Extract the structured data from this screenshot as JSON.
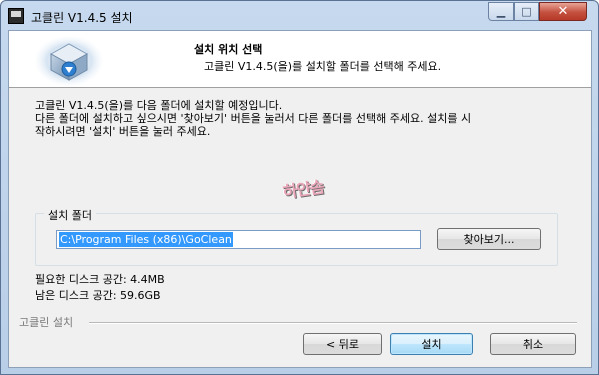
{
  "window": {
    "title": "고클린 V1.4.5 설치",
    "minimize_glyph": "▁",
    "maximize_glyph": "□",
    "close_glyph": "✕"
  },
  "header": {
    "title": "설치 위치 선택",
    "subtitle": "고클린 V1.4.5(을)를 설치할 폴더를 선택해 주세요."
  },
  "intro": {
    "line1": "고클린 V1.4.5(을)를 다음 폴더에 설치할 예정입니다.",
    "line2": "다른 폴더에 설치하고 싶으시면 '찾아보기' 버튼을 눌러서 다른 폴더를 선택해 주세요. 설치를 시",
    "line3": "작하시려면 '설치' 버튼을 눌러 주세요."
  },
  "watermark": {
    "text": "하얀솜"
  },
  "destination": {
    "group_label": "설치 폴더",
    "folder_value": "C:\\Program Files (x86)\\GoClean",
    "browse_label": "찾아보기..."
  },
  "space": {
    "required": "필요한 디스크 공간: 4.4MB",
    "available": "남은 디스크 공간: 59.6GB"
  },
  "footer": {
    "brand": "고클린 설치",
    "back_label": "< 뒤로",
    "install_label": "설치",
    "cancel_label": "취소"
  },
  "colors": {
    "title_bar": "#c6d9ee",
    "close_button": "#c4503f",
    "selection": "#3399ff",
    "default_button": "#a7d9f5"
  },
  "icons": [
    "app-icon",
    "minimize-icon",
    "maximize-icon",
    "close-icon",
    "installer-logo-icon"
  ]
}
